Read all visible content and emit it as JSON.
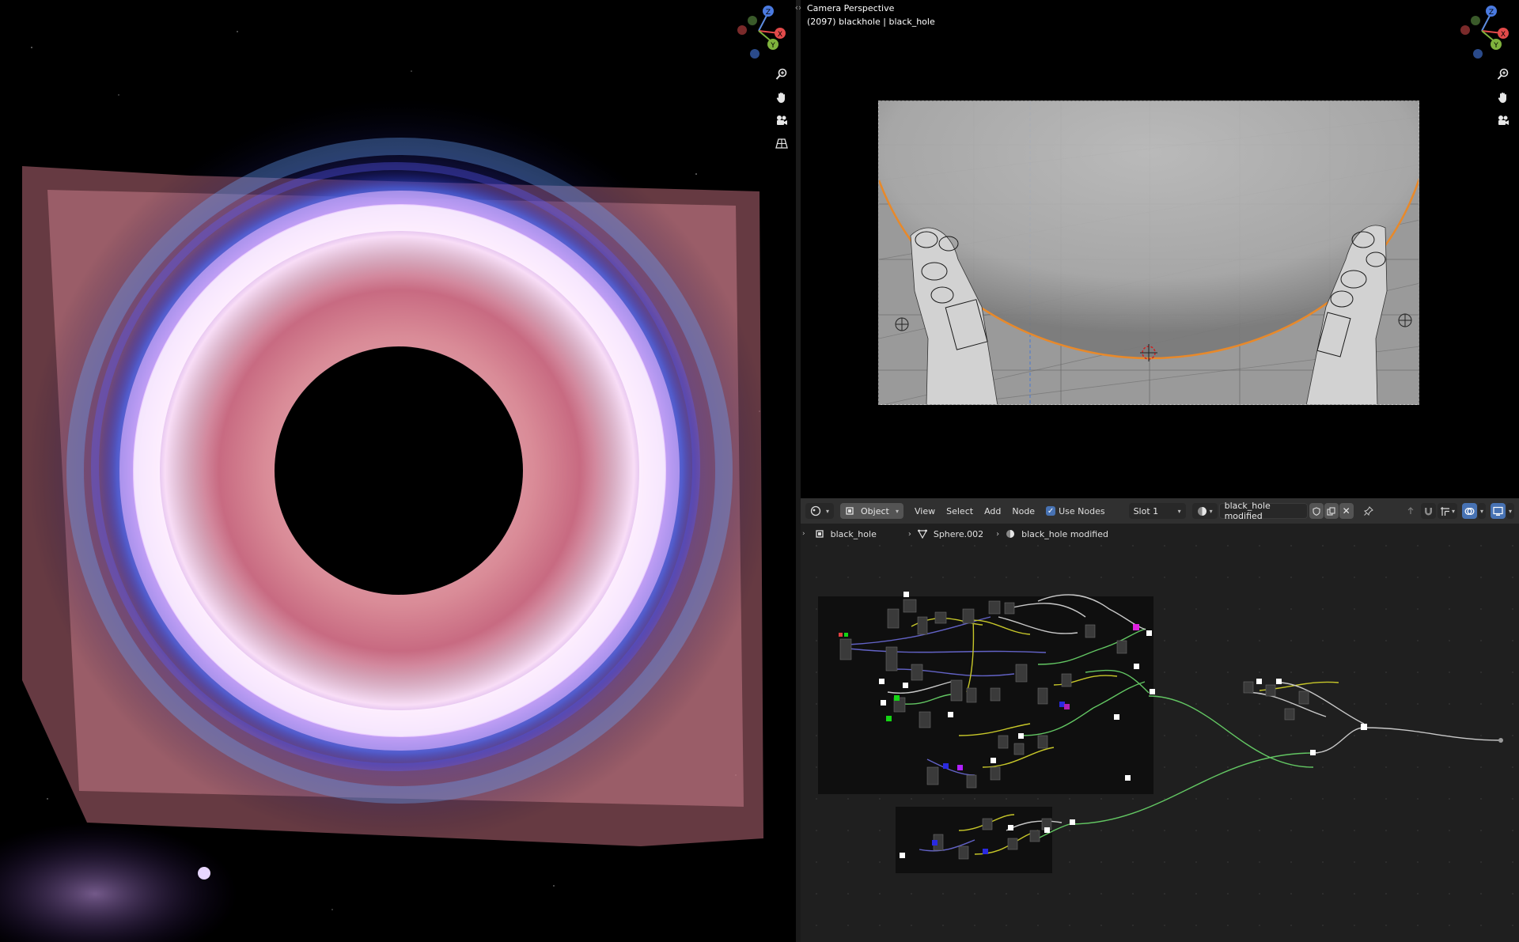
{
  "viewport": {
    "title": "Camera Perspective",
    "subtitle": "(2097) blackhole | black_hole",
    "split_toggle": "‹›"
  },
  "gizmo": {
    "x_label": "X",
    "y_label": "Y",
    "z_label": "Z"
  },
  "left_tools": [
    "zoom-icon",
    "hand-pan-icon",
    "camera-icon",
    "grid-ortho-icon"
  ],
  "right_tools": [
    "zoom-icon",
    "hand-pan-icon",
    "camera-icon"
  ],
  "node_editor": {
    "editor_type": "Shader Editor",
    "object_mode": "Object",
    "menus": [
      "View",
      "Select",
      "Add",
      "Node"
    ],
    "use_nodes_label": "Use Nodes",
    "use_nodes_checked": true,
    "slot": "Slot 1",
    "material_name": "black_hole modified",
    "breadcrumb": [
      "black_hole",
      "Sphere.002",
      "black_hole modified"
    ]
  },
  "colors": {
    "accent_blue": "#4772b3",
    "outline_orange": "#e8892a",
    "socket_green": "#63c763",
    "socket_yellow": "#c7c729",
    "socket_purple": "#6363c7"
  }
}
